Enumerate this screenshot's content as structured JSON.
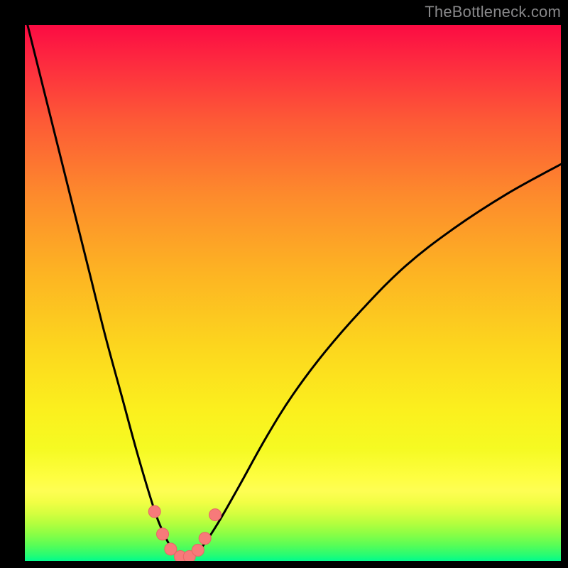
{
  "watermark": "TheBottleneck.com",
  "colors": {
    "frame": "#000000",
    "curve": "#000000",
    "marker_fill": "#f77a7a",
    "marker_stroke": "#e96565",
    "gradient_top": "#fc0b43",
    "gradient_bottom": "#02fb8d"
  },
  "chart_data": {
    "type": "line",
    "title": "",
    "xlabel": "",
    "ylabel": "",
    "xlim": [
      0,
      100
    ],
    "ylim": [
      0,
      100
    ],
    "grid": false,
    "series": [
      {
        "name": "bottleneck-curve",
        "x": [
          0,
          3,
          6,
          9,
          12,
          15,
          18,
          21,
          24,
          25.5,
          27,
          28.5,
          30,
          31.5,
          33,
          36,
          40,
          45,
          50,
          56,
          63,
          71,
          80,
          90,
          100
        ],
        "y": [
          102,
          90,
          78,
          66,
          54,
          42,
          31,
          20,
          10,
          6,
          3,
          1.2,
          0.6,
          1.0,
          2.5,
          7,
          14,
          23,
          31,
          39,
          47,
          55,
          62,
          68.5,
          74
        ]
      }
    ],
    "markers": [
      {
        "x": 24.2,
        "y": 9.2
      },
      {
        "x": 25.7,
        "y": 5.0
      },
      {
        "x": 27.2,
        "y": 2.2
      },
      {
        "x": 29.0,
        "y": 0.8
      },
      {
        "x": 30.7,
        "y": 0.8
      },
      {
        "x": 32.3,
        "y": 2.0
      },
      {
        "x": 33.6,
        "y": 4.2
      },
      {
        "x": 35.5,
        "y": 8.6
      }
    ]
  }
}
